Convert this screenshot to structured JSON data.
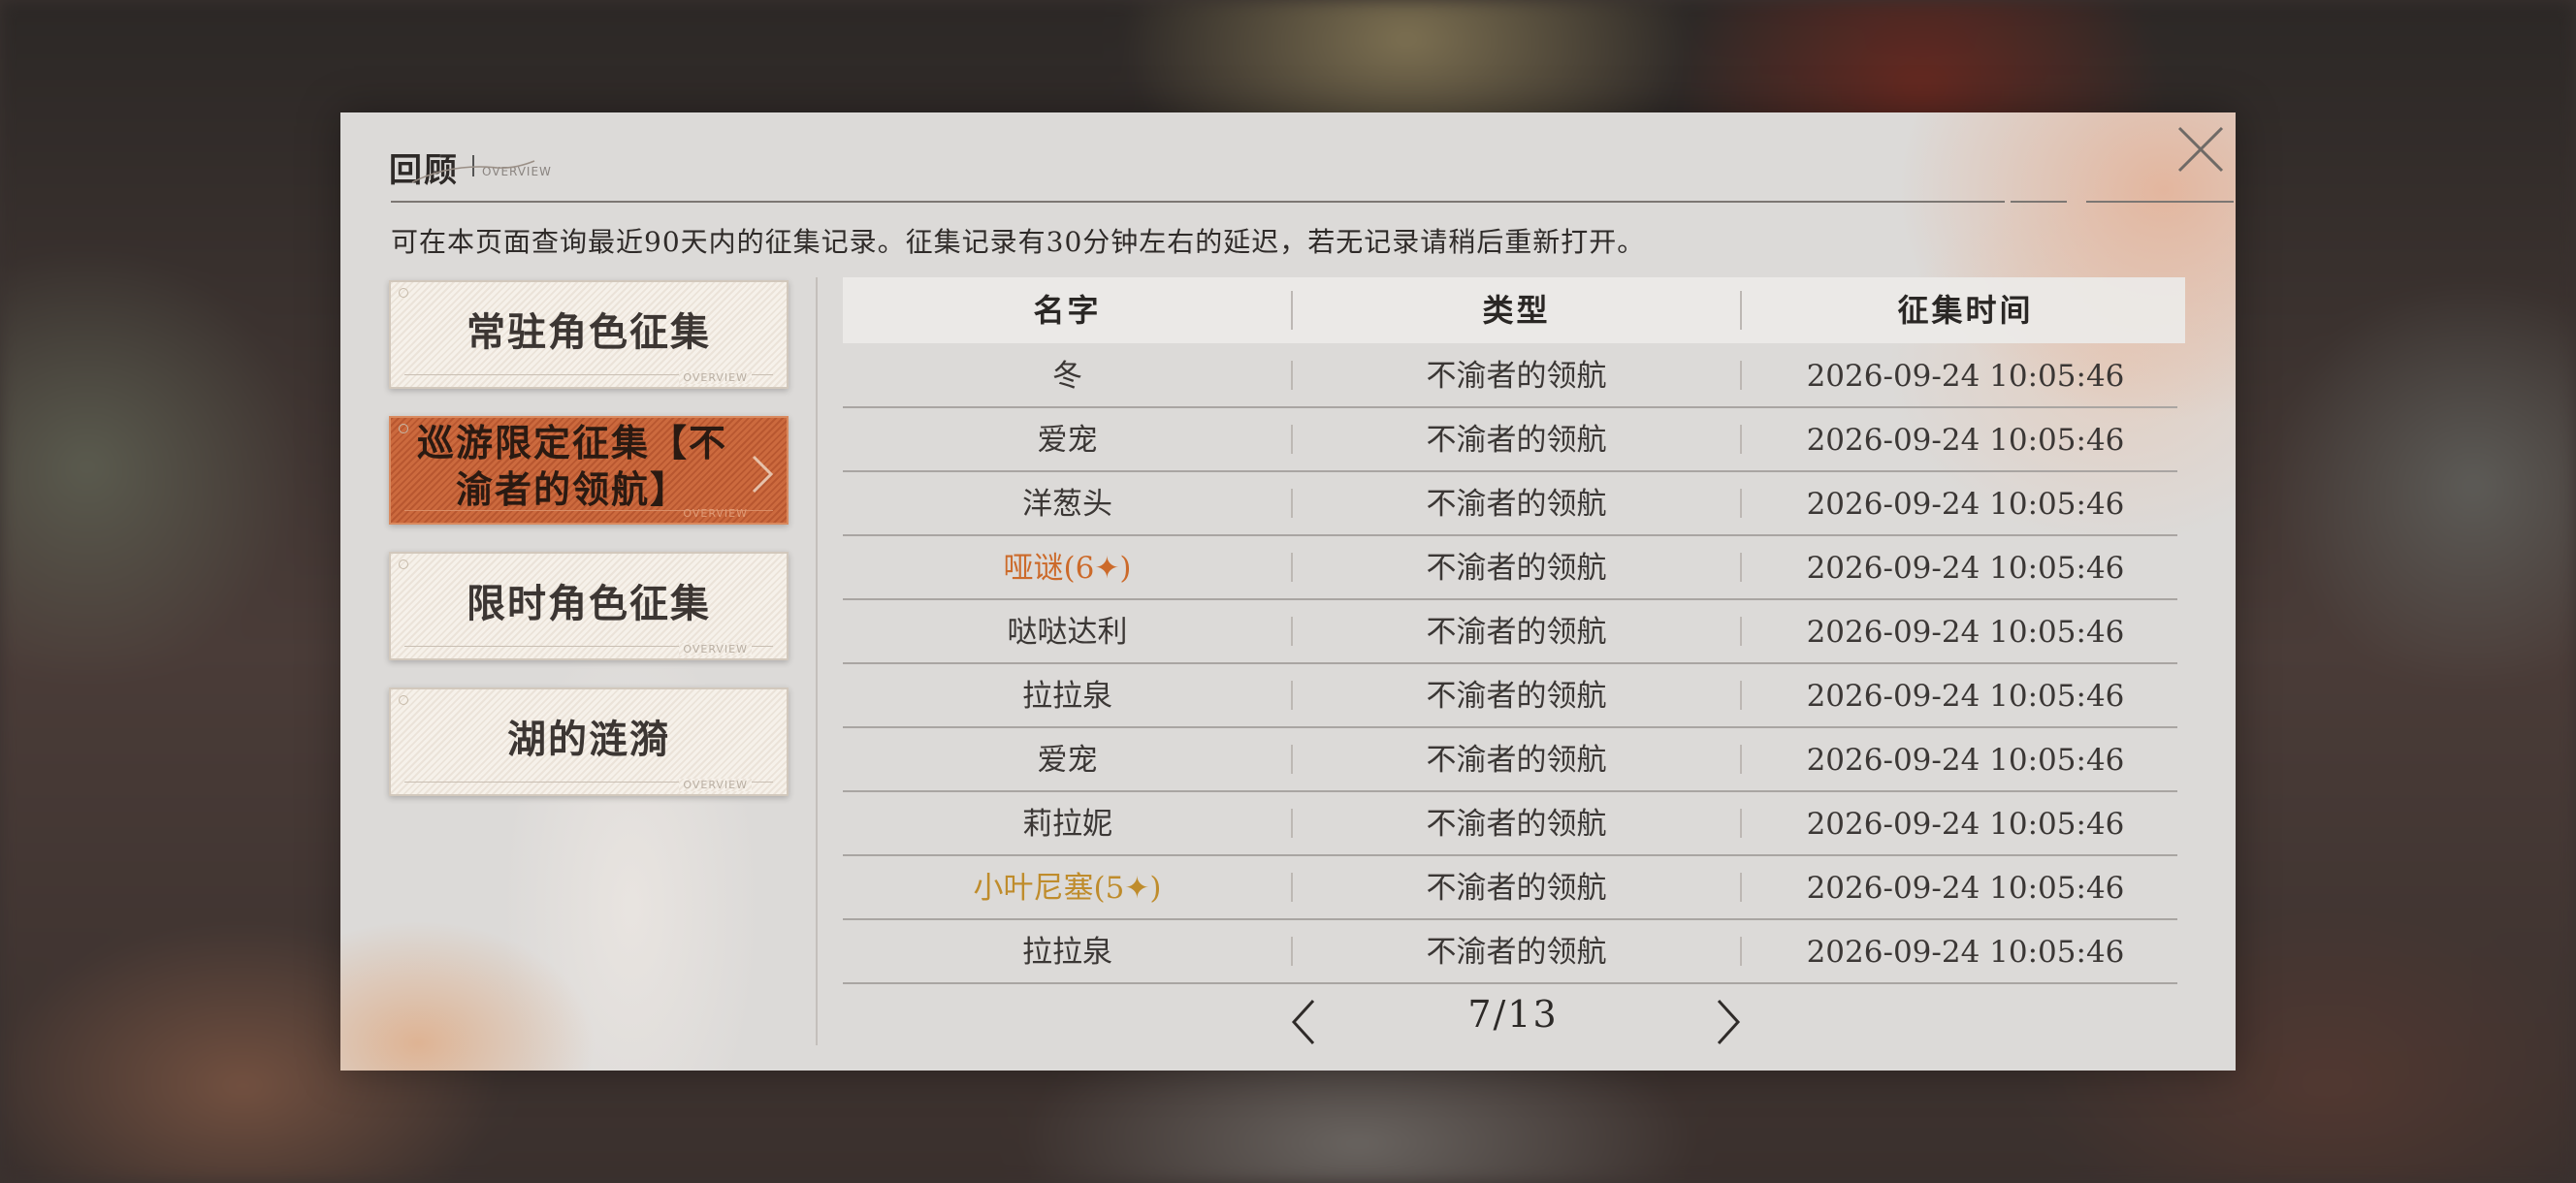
{
  "dialog": {
    "title": "回顾",
    "title_sub": "OVERVIEW",
    "description": "可在本页面查询最近90天内的征集记录。征集记录有30分钟左右的延迟，若无记录请稍后重新打开。"
  },
  "banners": [
    {
      "label": "常驻角色征集",
      "tag": "OVERVIEW",
      "active": false
    },
    {
      "label": "巡游限定征集【不渝者的领航】",
      "tag": "OVERVIEW",
      "active": true
    },
    {
      "label": "限时角色征集",
      "tag": "OVERVIEW",
      "active": false
    },
    {
      "label": "湖的涟漪",
      "tag": "OVERVIEW",
      "active": false
    }
  ],
  "table": {
    "headers": [
      "名字",
      "类型",
      "征集时间"
    ],
    "rows": [
      {
        "name": "冬",
        "type": "不渝者的领航",
        "time": "2026-09-24 10:05:46",
        "rarity": "normal"
      },
      {
        "name": "爱宠",
        "type": "不渝者的领航",
        "time": "2026-09-24 10:05:46",
        "rarity": "normal"
      },
      {
        "name": "洋葱头",
        "type": "不渝者的领航",
        "time": "2026-09-24 10:05:46",
        "rarity": "normal"
      },
      {
        "name": "哑谜(6✦)",
        "type": "不渝者的领航",
        "time": "2026-09-24 10:05:46",
        "rarity": "six"
      },
      {
        "name": "哒哒达利",
        "type": "不渝者的领航",
        "time": "2026-09-24 10:05:46",
        "rarity": "normal"
      },
      {
        "name": "拉拉泉",
        "type": "不渝者的领航",
        "time": "2026-09-24 10:05:46",
        "rarity": "normal"
      },
      {
        "name": "爱宠",
        "type": "不渝者的领航",
        "time": "2026-09-24 10:05:46",
        "rarity": "normal"
      },
      {
        "name": "莉拉妮",
        "type": "不渝者的领航",
        "time": "2026-09-24 10:05:46",
        "rarity": "normal"
      },
      {
        "name": "小叶尼塞(5✦)",
        "type": "不渝者的领航",
        "time": "2026-09-24 10:05:46",
        "rarity": "five"
      },
      {
        "name": "拉拉泉",
        "type": "不渝者的领航",
        "time": "2026-09-24 10:05:46",
        "rarity": "normal"
      }
    ]
  },
  "pagination": {
    "label": "7/13",
    "current": 7,
    "total": 13
  },
  "colors": {
    "accent_orange": "#cc6a2a",
    "accent_gold": "#bf8c2c",
    "active_banner": "#c05e34"
  },
  "icons": {
    "close": "close-x-icon",
    "prev": "chevron-left-icon",
    "next": "chevron-right-icon",
    "banner_arrow": "chevron-right-icon"
  }
}
